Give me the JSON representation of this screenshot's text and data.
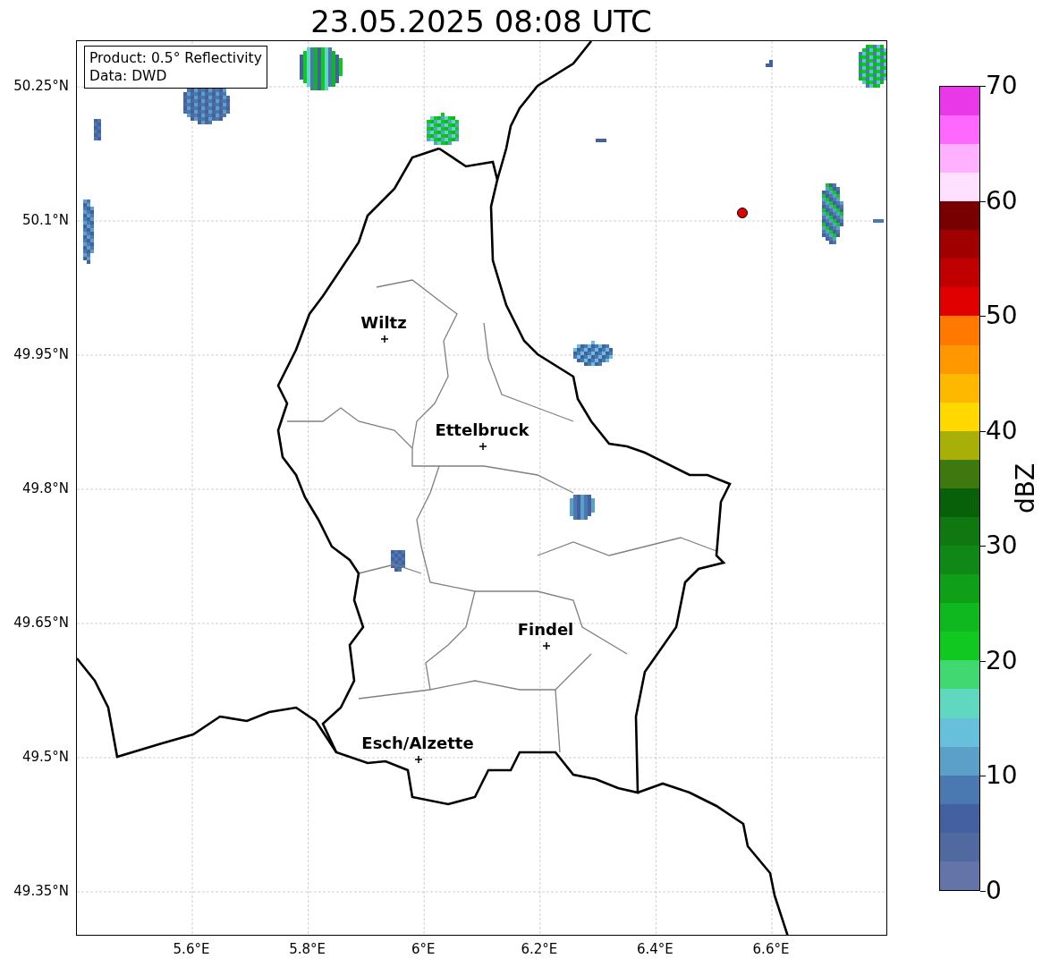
{
  "title": "23.05.2025 08:08 UTC",
  "info_box": [
    "Product: 0.5° Reflectivity",
    "Data: DWD"
  ],
  "y_ticks": [
    "50.25°N",
    "50.1°N",
    "49.95°N",
    "49.8°N",
    "49.65°N",
    "49.5°N",
    "49.35°N"
  ],
  "x_ticks": [
    "5.6°E",
    "5.8°E",
    "6°E",
    "6.2°E",
    "6.4°E",
    "6.6°E"
  ],
  "cities": [
    {
      "name": "Wiltz"
    },
    {
      "name": "Ettelbruck"
    },
    {
      "name": "Findel"
    },
    {
      "name": "Esch/Alzette"
    }
  ],
  "colorbar": {
    "label": "dBZ",
    "ticks": [
      "70",
      "60",
      "50",
      "40",
      "30",
      "20",
      "10",
      "0"
    ],
    "bands": [
      {
        "color": "#6474a8"
      },
      {
        "color": "#506aa0"
      },
      {
        "color": "#4460a0"
      },
      {
        "color": "#4a78b0"
      },
      {
        "color": "#5aa0c8"
      },
      {
        "color": "#66c0dc"
      },
      {
        "color": "#60d8c0"
      },
      {
        "color": "#40d870"
      },
      {
        "color": "#10c820"
      },
      {
        "color": "#10b820"
      },
      {
        "color": "#10a018"
      },
      {
        "color": "#108818"
      },
      {
        "color": "#107810"
      },
      {
        "color": "#086008"
      },
      {
        "color": "#407810"
      },
      {
        "color": "#a8b008"
      },
      {
        "color": "#ffd800"
      },
      {
        "color": "#ffb800"
      },
      {
        "color": "#ff9800"
      },
      {
        "color": "#ff7800"
      },
      {
        "color": "#e00000"
      },
      {
        "color": "#c00000"
      },
      {
        "color": "#a00000"
      },
      {
        "color": "#780000"
      },
      {
        "color": "#ffe0ff"
      },
      {
        "color": "#ffb0ff"
      },
      {
        "color": "#ff68ff"
      },
      {
        "color": "#e838e8"
      }
    ]
  }
}
